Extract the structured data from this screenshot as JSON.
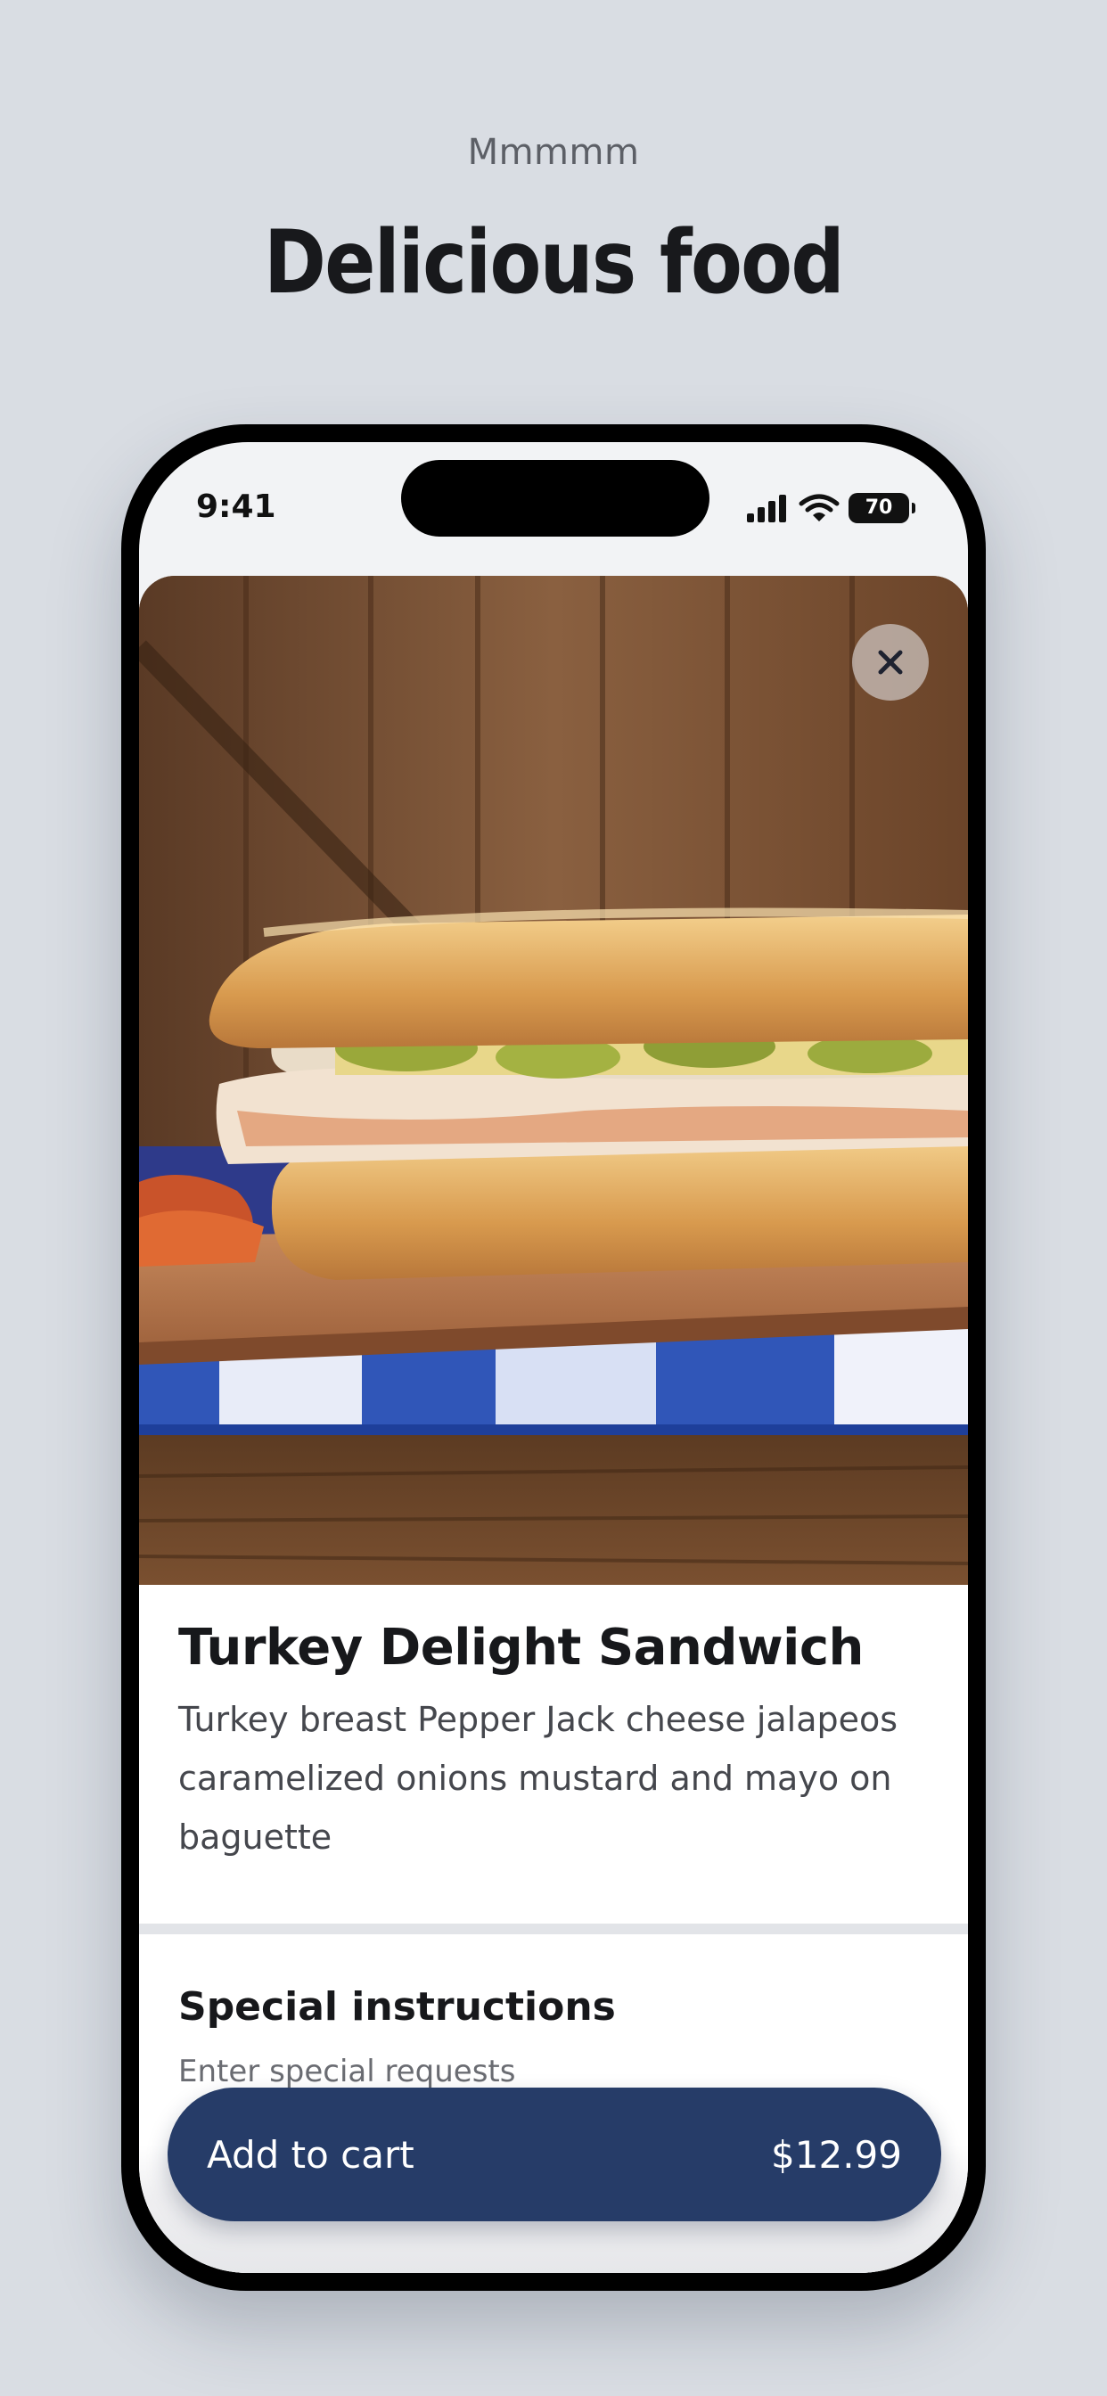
{
  "header": {
    "kicker": "Mmmmm",
    "title": "Delicious food"
  },
  "status_bar": {
    "time": "9:41",
    "battery_level": "70",
    "icons": [
      "signal-icon",
      "wifi-icon",
      "battery-icon"
    ]
  },
  "product": {
    "image_icon": "sandwich-photo",
    "name": "Turkey Delight Sandwich",
    "description": "Turkey breast Pepper Jack cheese jalapeos caramelized onions mustard and mayo on baguette"
  },
  "special_instructions": {
    "title": "Special instructions",
    "placeholder": "Enter special requests"
  },
  "cart": {
    "label": "Add to cart",
    "price": "$12.99"
  },
  "colors": {
    "background": "#d9dde3",
    "primary_button": "#263c68",
    "title_text": "#17181b"
  }
}
